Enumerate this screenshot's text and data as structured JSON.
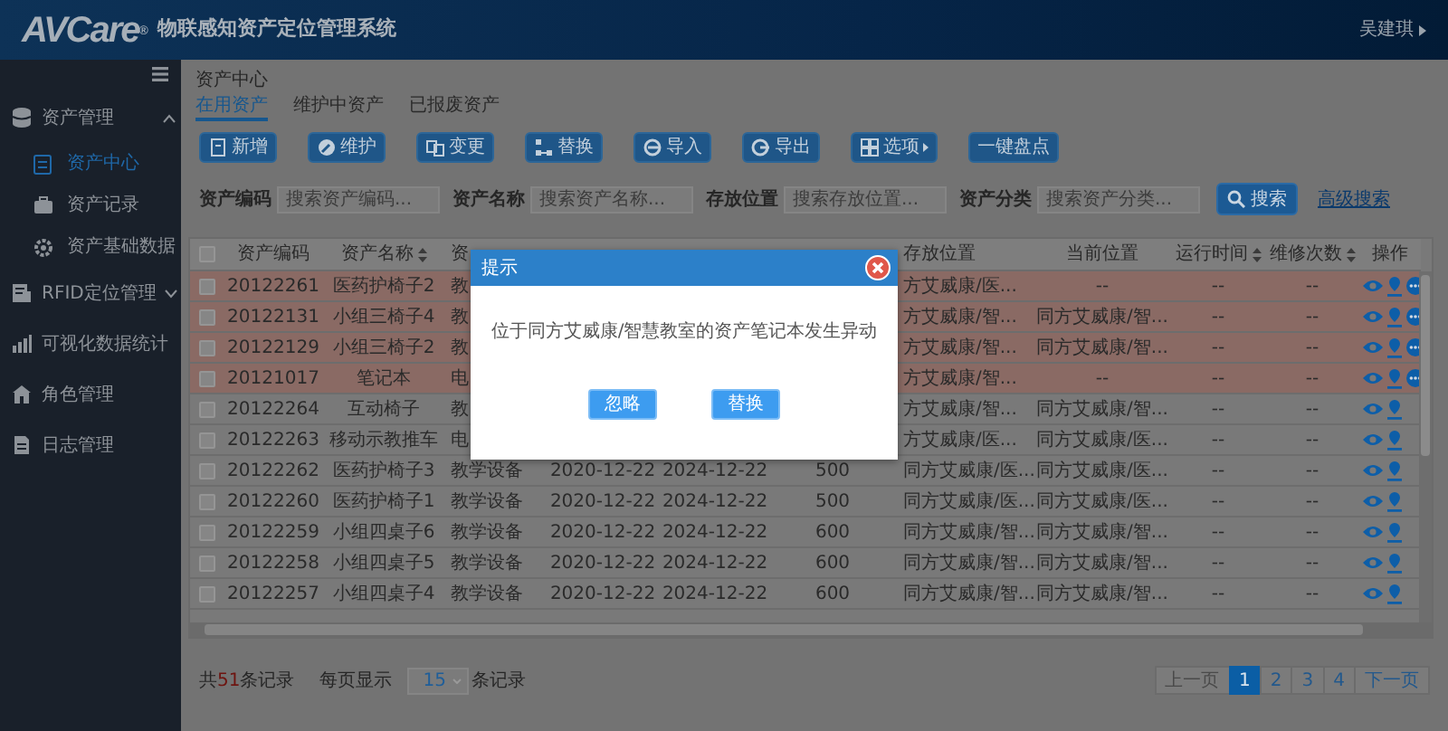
{
  "header": {
    "logo": "AVCare",
    "logo_mark": "®",
    "title": "物联感知资产定位管理系统",
    "user": "吴建琪"
  },
  "sidebar": {
    "items": [
      {
        "label": "资产管理",
        "kind": "group",
        "expanded": true,
        "children": [
          {
            "label": "资产中心",
            "selected": true
          },
          {
            "label": "资产记录",
            "selected": false
          },
          {
            "label": "资产基础数据",
            "selected": false
          }
        ]
      },
      {
        "label": "RFID定位管理",
        "kind": "group",
        "expanded": false
      },
      {
        "label": "可视化数据统计",
        "kind": "link"
      },
      {
        "label": "角色管理",
        "kind": "link"
      },
      {
        "label": "日志管理",
        "kind": "link"
      }
    ]
  },
  "breadcrumb": "资产中心",
  "tabs": [
    {
      "label": "在用资产",
      "selected": true
    },
    {
      "label": "维护中资产",
      "selected": false
    },
    {
      "label": "已报废资产",
      "selected": false
    }
  ],
  "toolbar": [
    {
      "label": "新增",
      "kind": "plain"
    },
    {
      "label": "维护",
      "kind": "plain"
    },
    {
      "label": "变更",
      "kind": "plain"
    },
    {
      "label": "替换",
      "kind": "plain"
    },
    {
      "label": "导入",
      "kind": "plain"
    },
    {
      "label": "导出",
      "kind": "plain"
    },
    {
      "label": "选项",
      "kind": "menu"
    },
    {
      "label": "一键盘点",
      "kind": "text"
    }
  ],
  "search": {
    "fields": [
      {
        "label": "资产编码",
        "placeholder": "搜索资产编码..."
      },
      {
        "label": "资产名称",
        "placeholder": "搜索资产名称..."
      },
      {
        "label": "存放位置",
        "placeholder": "搜索存放位置..."
      },
      {
        "label": "资产分类",
        "placeholder": "搜索资产分类..."
      }
    ],
    "button": "搜索",
    "advanced": "高级搜索"
  },
  "table": {
    "all_checked": false,
    "columns": [
      {
        "label": "资产编码",
        "sortable": false
      },
      {
        "label": "资产名称",
        "sortable": true
      },
      {
        "label": "资",
        "sortable": false
      },
      null,
      null,
      null,
      {
        "label": "存放位置",
        "sortable": false
      },
      {
        "label": "当前位置",
        "sortable": false
      },
      {
        "label": "运行时间",
        "sortable": true
      },
      {
        "label": "维修次数",
        "sortable": true
      },
      {
        "label": "操作",
        "sortable": false
      }
    ],
    "rows": [
      {
        "alert": true,
        "checked": false,
        "cells": [
          "20122261",
          "医药护椅子2",
          "教",
          null,
          null,
          null,
          "方艾威康/医...",
          "--",
          "--",
          "--"
        ],
        "more_action": true
      },
      {
        "alert": true,
        "checked": false,
        "cells": [
          "20122131",
          "小组三椅子4",
          "教",
          null,
          null,
          null,
          "方艾威康/智...",
          "同方艾威康/智...",
          "--",
          "--"
        ],
        "more_action": true
      },
      {
        "alert": true,
        "checked": false,
        "cells": [
          "20122129",
          "小组三椅子2",
          "教",
          null,
          null,
          null,
          "方艾威康/智...",
          "同方艾威康/智...",
          "--",
          "--"
        ],
        "more_action": true
      },
      {
        "alert": true,
        "checked": false,
        "cells": [
          "20121017",
          "笔记本",
          "电",
          null,
          null,
          null,
          "方艾威康/智...",
          "--",
          "--",
          "--"
        ],
        "more_action": true
      },
      {
        "alert": false,
        "checked": false,
        "cells": [
          "20122264",
          "互动椅子",
          "教",
          null,
          null,
          null,
          "方艾威康/智...",
          "同方艾威康/智...",
          "--",
          "--"
        ],
        "more_action": false
      },
      {
        "alert": false,
        "checked": false,
        "cells": [
          "20122263",
          "移动示教推车",
          "电",
          null,
          null,
          null,
          "方艾威康/医...",
          "同方艾威康/医...",
          "--",
          "--"
        ],
        "more_action": false
      },
      {
        "alert": false,
        "checked": false,
        "cells": [
          "20122262",
          "医药护椅子3",
          "教学设备",
          "2020-12-22",
          "2024-12-22",
          "500",
          "同方艾威康/医...",
          "同方艾威康/医...",
          "--",
          "--"
        ],
        "more_action": false
      },
      {
        "alert": false,
        "checked": false,
        "cells": [
          "20122260",
          "医药护椅子1",
          "教学设备",
          "2020-12-22",
          "2024-12-22",
          "500",
          "同方艾威康/医...",
          "同方艾威康/医...",
          "--",
          "--"
        ],
        "more_action": false
      },
      {
        "alert": false,
        "checked": false,
        "cells": [
          "20122259",
          "小组四桌子6",
          "教学设备",
          "2020-12-22",
          "2024-12-22",
          "600",
          "同方艾威康/智...",
          "同方艾威康/智...",
          "--",
          "--"
        ],
        "more_action": false
      },
      {
        "alert": false,
        "checked": false,
        "cells": [
          "20122258",
          "小组四桌子5",
          "教学设备",
          "2020-12-22",
          "2024-12-22",
          "600",
          "同方艾威康/智...",
          "同方艾威康/智...",
          "--",
          "--"
        ],
        "more_action": false
      },
      {
        "alert": false,
        "checked": false,
        "cells": [
          "20122257",
          "小组四桌子4",
          "教学设备",
          "2020-12-22",
          "2024-12-22",
          "600",
          "同方艾威康/智...",
          "同方艾威康/智...",
          "--",
          "--"
        ],
        "more_action": false
      }
    ]
  },
  "footer": {
    "total_prefix": "共",
    "total_count": "51",
    "total_suffix": "条记录",
    "page_size_label": "每页显示",
    "page_size": "15",
    "page_size_suffix": "条记录"
  },
  "pagination": [
    {
      "label": "上一页",
      "selected": false,
      "disabled": true
    },
    {
      "label": "1",
      "selected": true,
      "disabled": false
    },
    {
      "label": "2",
      "selected": false,
      "disabled": false
    },
    {
      "label": "3",
      "selected": false,
      "disabled": false
    },
    {
      "label": "4",
      "selected": false,
      "disabled": false
    },
    {
      "label": "下一页",
      "selected": false,
      "disabled": false
    }
  ],
  "modal": {
    "title": "提示",
    "message": "位于同方艾威康/智慧教室的资产笔记本发生异动",
    "buttons": [
      "忽略",
      "替换"
    ]
  }
}
